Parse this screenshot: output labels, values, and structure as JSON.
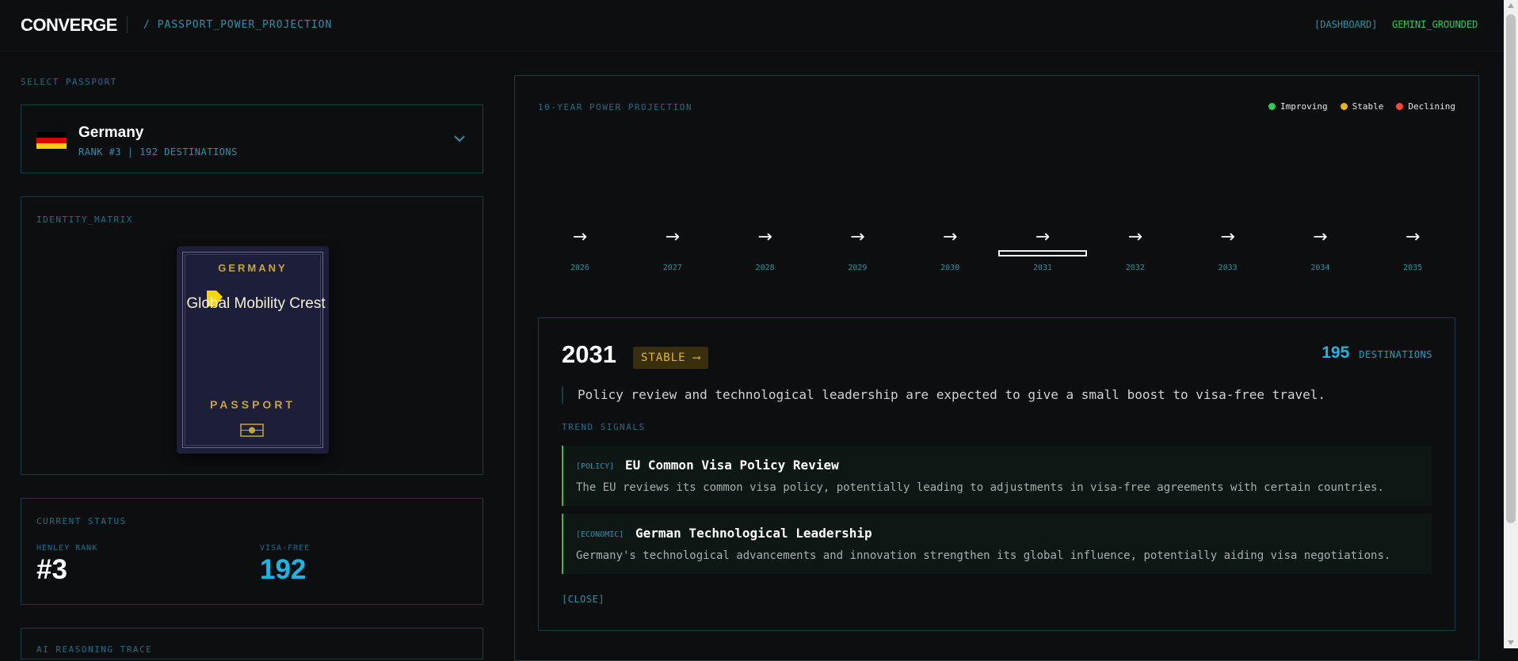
{
  "header": {
    "logo": "CONVERGE",
    "breadcrumb": "/ PASSPORT_POWER_PROJECTION",
    "nav_dashboard": "[DASHBOARD]",
    "nav_gemini": "GEMINI_GROUNDED"
  },
  "select": {
    "label": "SELECT PASSPORT",
    "country": "Germany",
    "subtitle": "RANK #3 | 192 DESTINATIONS",
    "flag_colors": [
      "#000000",
      "#dd0000",
      "#ffce00"
    ]
  },
  "identity": {
    "label": "IDENTITY_MATRIX",
    "passport_country": "GERMANY",
    "crest_text": "Global Mobility Crest",
    "passport_word": "PASSPORT"
  },
  "status": {
    "label": "CURRENT STATUS",
    "henley_label": "HENLEY RANK",
    "henley_value": "#3",
    "visa_label": "VISA-FREE",
    "visa_value": "192"
  },
  "trace": {
    "label": "AI REASONING TRACE"
  },
  "projection": {
    "title": "10-YEAR POWER PROJECTION",
    "legend": [
      {
        "label": "Improving",
        "color": "#34c759"
      },
      {
        "label": "Stable",
        "color": "#e6b422"
      },
      {
        "label": "Declining",
        "color": "#ff453a"
      }
    ],
    "years": [
      {
        "year": "2026",
        "arrow": "→",
        "trend": "stable"
      },
      {
        "year": "2027",
        "arrow": "→",
        "trend": "stable"
      },
      {
        "year": "2028",
        "arrow": "→",
        "trend": "stable"
      },
      {
        "year": "2029",
        "arrow": "→",
        "trend": "stable"
      },
      {
        "year": "2030",
        "arrow": "→",
        "trend": "stable"
      },
      {
        "year": "2031",
        "arrow": "→",
        "trend": "stable",
        "selected": true
      },
      {
        "year": "2032",
        "arrow": "→",
        "trend": "stable"
      },
      {
        "year": "2033",
        "arrow": "→",
        "trend": "stable"
      },
      {
        "year": "2034",
        "arrow": "→",
        "trend": "stable"
      },
      {
        "year": "2035",
        "arrow": "→",
        "trend": "stable"
      }
    ]
  },
  "detail": {
    "year": "2031",
    "badge": "STABLE ⟶",
    "destinations": "195",
    "destinations_label": "DESTINATIONS",
    "summary": "Policy review and technological leadership are expected to give a small boost to visa-free travel.",
    "signals_label": "TREND SIGNALS",
    "signals": [
      {
        "category": "[POLICY]",
        "title": "EU Common Visa Policy Review",
        "description": "The EU reviews its common visa policy, potentially leading to adjustments in visa-free agreements with certain countries."
      },
      {
        "category": "[ECONOMIC]",
        "title": "German Technological Leadership",
        "description": "Germany's technological advancements and innovation strengthen its global influence, potentially aiding visa negotiations."
      }
    ],
    "close": "[CLOSE]"
  }
}
